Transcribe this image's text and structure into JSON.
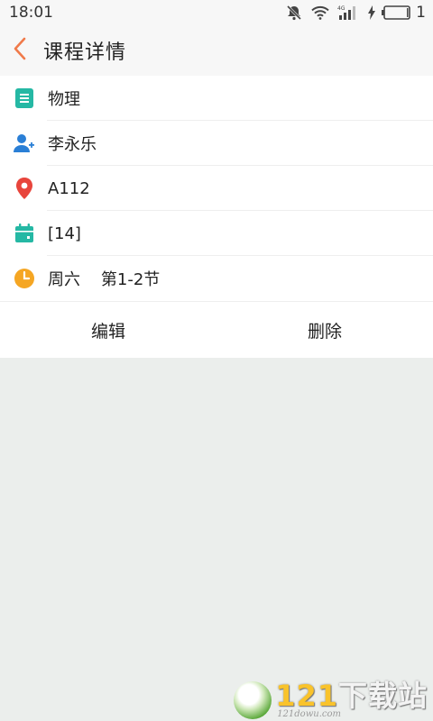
{
  "status_bar": {
    "time": "18:01",
    "battery_level": "1"
  },
  "header": {
    "title": "课程详情"
  },
  "details": [
    {
      "icon": "course-book-icon",
      "value": "物理"
    },
    {
      "icon": "teacher-person-icon",
      "value": "李永乐"
    },
    {
      "icon": "location-pin-icon",
      "value": "A112"
    },
    {
      "icon": "calendar-icon",
      "value": "[14]"
    },
    {
      "icon": "clock-icon",
      "value": "周六    第1-2节"
    }
  ],
  "actions": {
    "edit_label": "编辑",
    "delete_label": "删除"
  },
  "watermark": {
    "number": "121",
    "brand": "下载站",
    "url": "121dowu.com"
  },
  "colors": {
    "accent_orange": "#f07a4a",
    "teal": "#25b8a4",
    "blue": "#2a7fd6",
    "red": "#e8453c",
    "yellow": "#f5a623"
  }
}
